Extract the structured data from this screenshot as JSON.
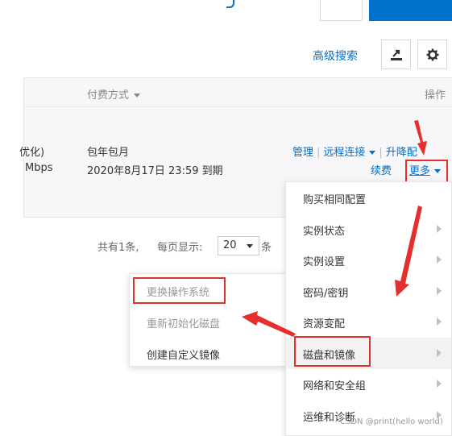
{
  "toolbar": {
    "advanced_search": "高级搜索",
    "export_icon": "export-icon",
    "settings_icon": "gear-icon"
  },
  "table": {
    "headers": {
      "payment": "付费方式",
      "actions": "操作"
    },
    "row": {
      "spec_line1": "优化)",
      "spec_line2": "Mbps",
      "payment_line1": "包年包月",
      "payment_line2": "2020年8月17日 23:59 到期",
      "actions": {
        "manage": "管理",
        "remote": "远程连接",
        "upgrade": "升降配",
        "renew": "续费",
        "more": "更多"
      }
    }
  },
  "pagination": {
    "total": "共有1条,",
    "per_page_label": "每页显示:",
    "page_size": "20",
    "suffix": "条"
  },
  "more_menu": {
    "items": [
      {
        "label": "购买相同配置",
        "has_sub": false
      },
      {
        "label": "实例状态",
        "has_sub": true
      },
      {
        "label": "实例设置",
        "has_sub": true
      },
      {
        "label": "密码/密钥",
        "has_sub": true
      },
      {
        "label": "资源变配",
        "has_sub": true
      },
      {
        "label": "磁盘和镜像",
        "has_sub": true
      },
      {
        "label": "网络和安全组",
        "has_sub": true
      },
      {
        "label": "运维和诊断",
        "has_sub": true
      }
    ]
  },
  "disk_submenu": {
    "items": [
      {
        "label": "更换操作系统",
        "disabled": true
      },
      {
        "label": "重新初始化磁盘",
        "disabled": true
      },
      {
        "label": "创建自定义镜像",
        "disabled": false
      }
    ]
  },
  "watermark": "CSDN @print(hello world)",
  "colors": {
    "primary": "#0070cc",
    "highlight": "#e52e2e",
    "header_bg": "#f7f7f7"
  }
}
